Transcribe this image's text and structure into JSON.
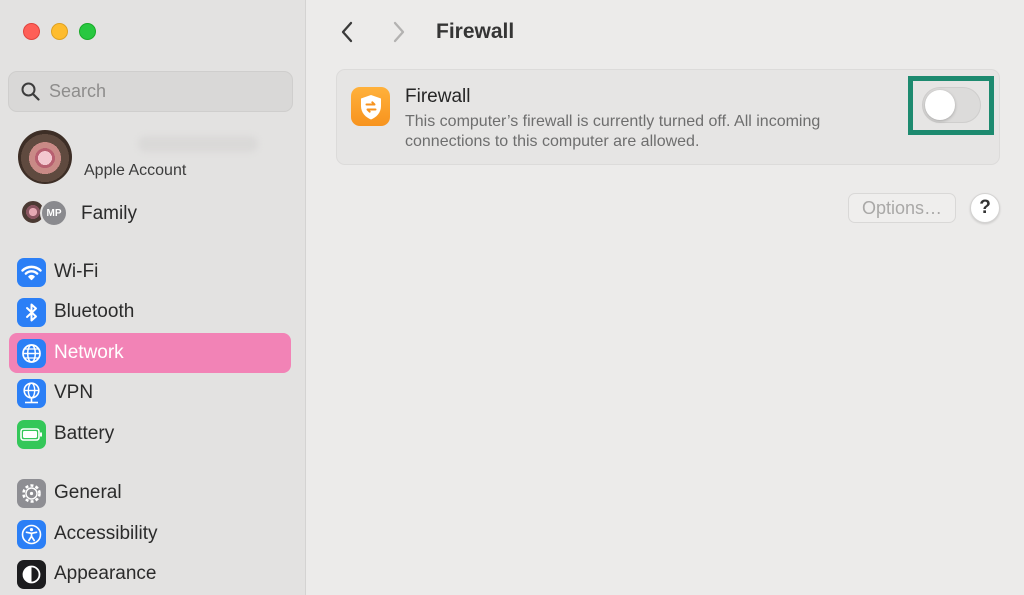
{
  "window": {
    "traffic_lights": [
      "close",
      "minimize",
      "zoom"
    ]
  },
  "sidebar": {
    "search": {
      "placeholder": "Search",
      "value": ""
    },
    "account": {
      "label": "Apple Account"
    },
    "family": {
      "badge": "MP",
      "label": "Family"
    },
    "items": [
      {
        "label": "Wi-Fi",
        "icon": "wifi-icon",
        "color": "#2b7ff6"
      },
      {
        "label": "Bluetooth",
        "icon": "bluetooth-icon",
        "color": "#2b7ff6"
      },
      {
        "label": "Network",
        "icon": "globe-icon",
        "color": "#2b7ff6",
        "selected": true
      },
      {
        "label": "VPN",
        "icon": "vpn-globe-icon",
        "color": "#2b7ff6"
      },
      {
        "label": "Battery",
        "icon": "battery-icon",
        "color": "#34c759"
      },
      {
        "label": "General",
        "icon": "gear-icon",
        "color": "#8e8e93"
      },
      {
        "label": "Accessibility",
        "icon": "accessibility-icon",
        "color": "#2b7ff6"
      },
      {
        "label": "Appearance",
        "icon": "appearance-icon",
        "color": "#1c1c1e"
      }
    ],
    "selected_color": "#f283b6"
  },
  "header": {
    "title": "Firewall"
  },
  "firewall": {
    "title": "Firewall",
    "description": "This computer’s firewall is currently turned off. All incoming connections to this computer are allowed.",
    "enabled": false,
    "icon_color": "#f7931e"
  },
  "actions": {
    "options_label": "Options…",
    "help_label": "?"
  },
  "annotation": {
    "highlight_color": "#1d8a6f"
  }
}
